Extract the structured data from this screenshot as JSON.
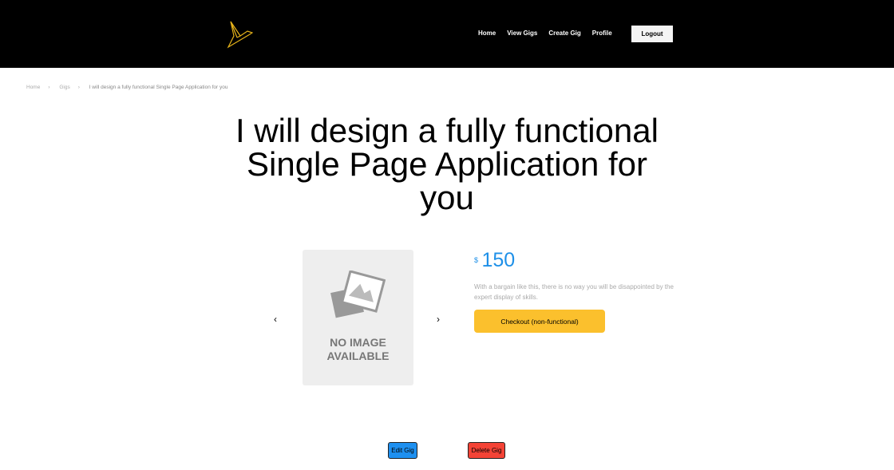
{
  "nav": {
    "logo": "bird-logo",
    "logo_color": "#e5b21a",
    "links": [
      "Home",
      "View Gigs",
      "Create Gig",
      "Profile"
    ],
    "logout": "Logout"
  },
  "breadcrumb": [
    "Home",
    "Gigs",
    "I will design a fully functional Single Page Application for you"
  ],
  "title": "I will design a fully functional Single Page Application for you",
  "gallery": {
    "placeholder_line1": "NO IMAGE",
    "placeholder_line2": "AVAILABLE",
    "prev": "‹",
    "next": "›"
  },
  "price": {
    "currency": "$",
    "amount": "150",
    "color": "#1e90e8"
  },
  "description": "With a bargain like this, there is no way you will be disappointed by the expert display of skills.",
  "checkout": "Checkout (non-functional)",
  "actions": {
    "edit": "Edit Gig",
    "delete": "Delete Gig"
  }
}
